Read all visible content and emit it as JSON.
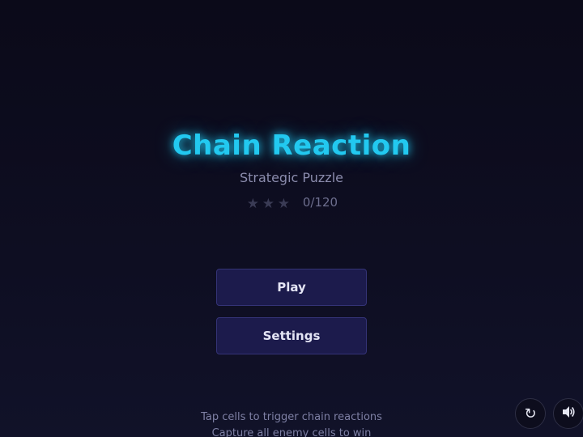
{
  "title": "Chain Reaction",
  "subtitle": "Strategic Puzzle",
  "stars": {
    "earned": 0,
    "slots": 3,
    "count_text": "0/120",
    "empty_color": "#3a3b55"
  },
  "menu": {
    "play_label": "Play",
    "settings_label": "Settings"
  },
  "hints": {
    "line1": "Tap cells to trigger chain reactions",
    "line2": "Capture all enemy cells to win"
  },
  "controls": {
    "restart_icon": "restart-icon",
    "sound_icon": "speaker-icon"
  },
  "colors": {
    "accent": "#22c9f0",
    "button_bg": "#1c1b4c",
    "background": "#0b0a19"
  }
}
